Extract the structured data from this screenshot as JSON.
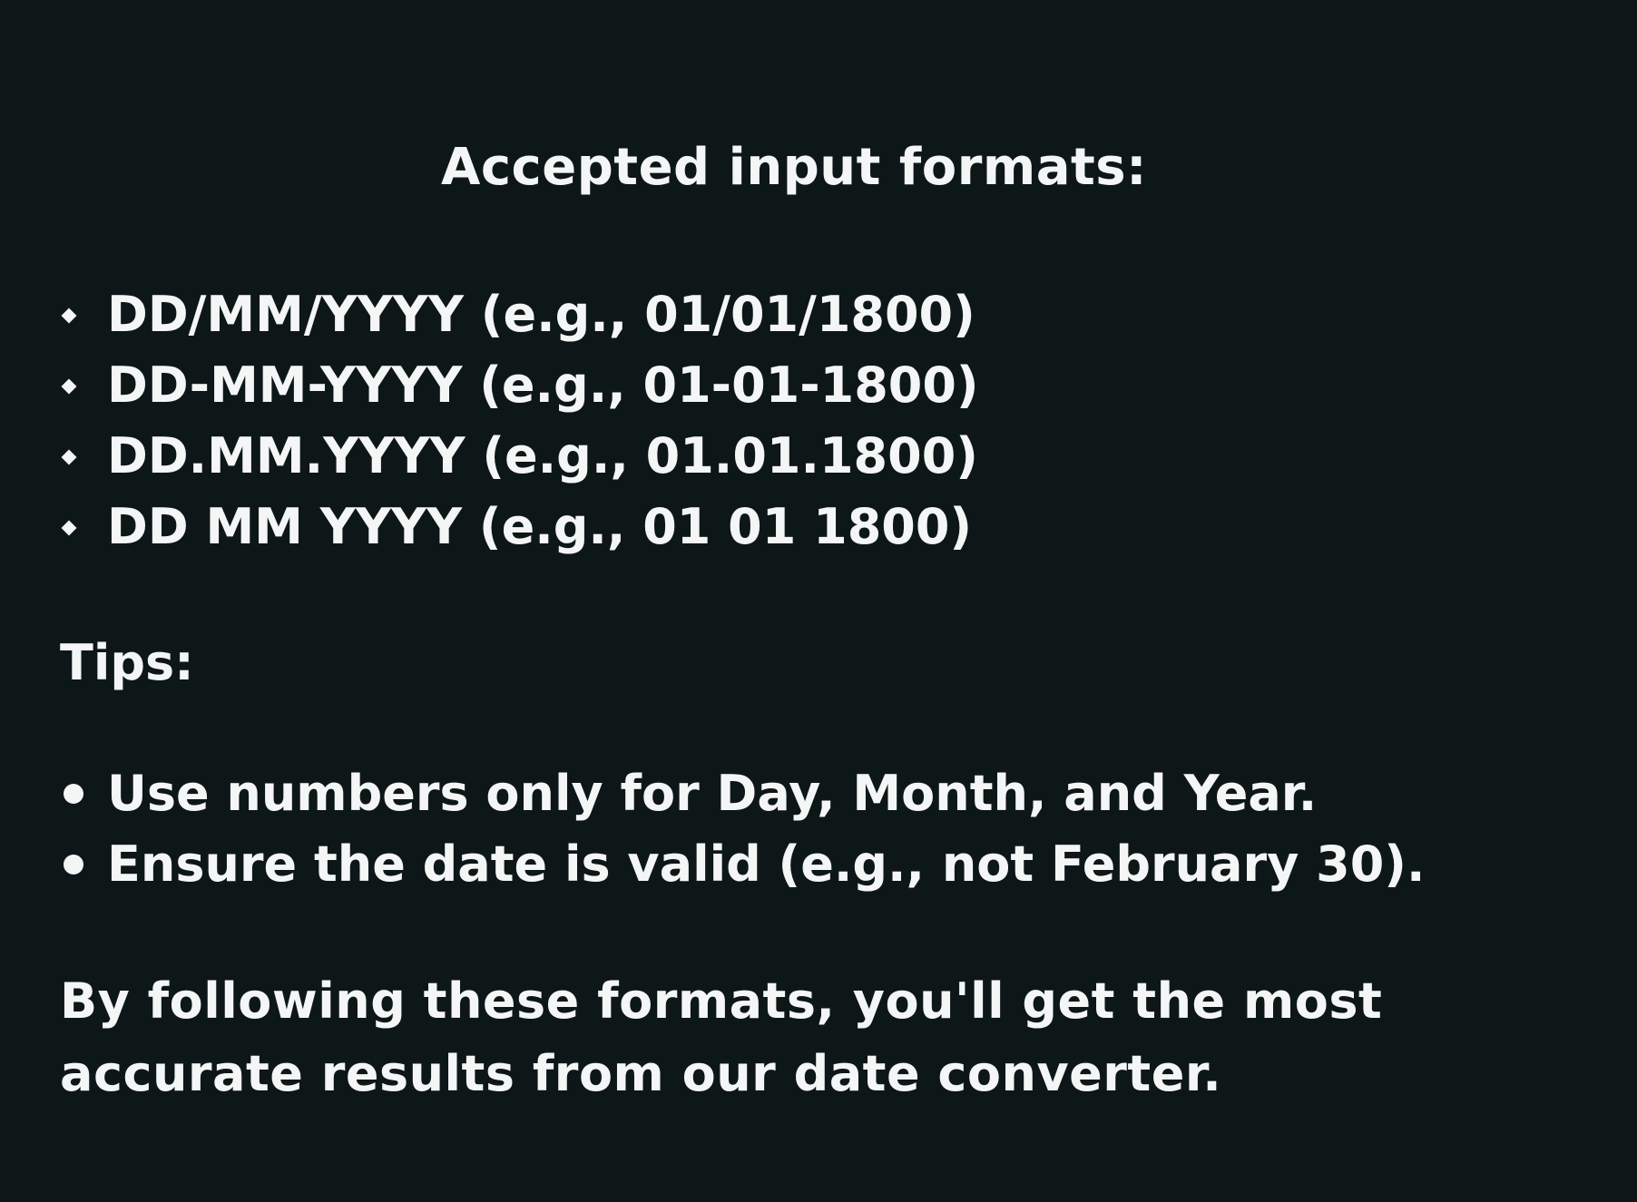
{
  "heading": "Accepted input formats:",
  "formats": [
    {
      "bullet_icon": "diamond-bullet-icon",
      "text": "DD/MM/YYYY (e.g., 01/01/1800)"
    },
    {
      "bullet_icon": "diamond-bullet-icon",
      "text": "DD-MM-YYYY (e.g., 01-01-1800)"
    },
    {
      "bullet_icon": "diamond-bullet-icon",
      "text": "DD.MM.YYYY (e.g., 01.01.1800)"
    },
    {
      "bullet_icon": "diamond-bullet-icon",
      "text": "DD MM YYYY (e.g., 01 01 1800)"
    }
  ],
  "tips_label": "Tips:",
  "tips": [
    {
      "bullet_icon": "dot-bullet-icon",
      "text": "Use numbers only for Day, Month, and Year."
    },
    {
      "bullet_icon": "dot-bullet-icon",
      "text": "Ensure the date is valid (e.g., not February 30)."
    }
  ],
  "closing": "By following these formats, you'll get the most accurate results from our date converter.",
  "colors": {
    "background": "#0e1718",
    "text": "#f4f6f6"
  }
}
